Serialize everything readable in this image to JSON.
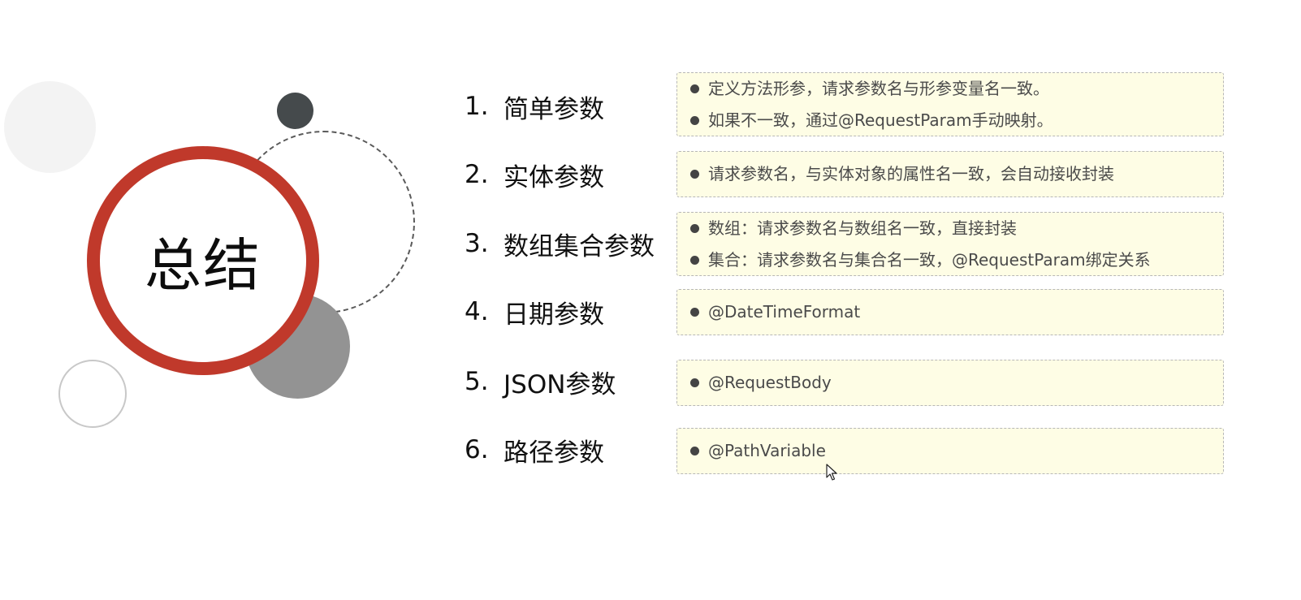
{
  "title": "总结",
  "items": [
    {
      "number": "1.",
      "label": "简单参数",
      "bullets": [
        "定义方法形参，请求参数名与形参变量名一致。",
        "如果不一致，通过@RequestParam手动映射。"
      ]
    },
    {
      "number": "2.",
      "label": "实体参数",
      "bullets": [
        "请求参数名，与实体对象的属性名一致，会自动接收封装"
      ]
    },
    {
      "number": "3.",
      "label": "数组集合参数",
      "bullets": [
        "数组：请求参数名与数组名一致，直接封装",
        "集合：请求参数名与集合名一致，@RequestParam绑定关系"
      ]
    },
    {
      "number": "4.",
      "label": "日期参数",
      "bullets": [
        "@DateTimeFormat"
      ]
    },
    {
      "number": "5.",
      "label": "JSON参数",
      "bullets": [
        "@RequestBody"
      ]
    },
    {
      "number": "6.",
      "label": "路径参数",
      "bullets": [
        "@PathVariable"
      ]
    }
  ],
  "colors": {
    "accent_ring": "#c0392b",
    "box_background": "#fefde5",
    "box_border": "#b7b7b7",
    "bullet_text": "#4a4a4a"
  }
}
